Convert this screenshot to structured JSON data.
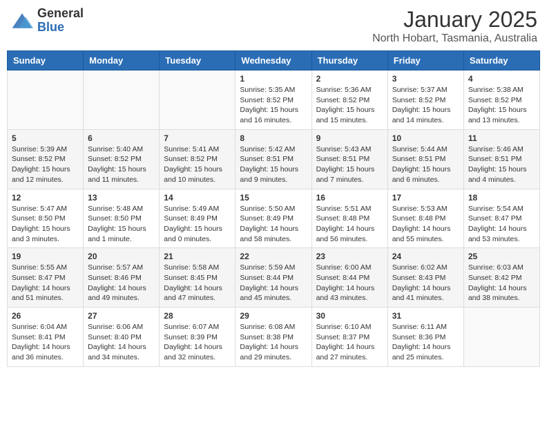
{
  "logo": {
    "general": "General",
    "blue": "Blue"
  },
  "header": {
    "month": "January 2025",
    "location": "North Hobart, Tasmania, Australia"
  },
  "weekdays": [
    "Sunday",
    "Monday",
    "Tuesday",
    "Wednesday",
    "Thursday",
    "Friday",
    "Saturday"
  ],
  "weeks": [
    [
      {
        "day": "",
        "info": ""
      },
      {
        "day": "",
        "info": ""
      },
      {
        "day": "",
        "info": ""
      },
      {
        "day": "1",
        "info": "Sunrise: 5:35 AM\nSunset: 8:52 PM\nDaylight: 15 hours\nand 16 minutes."
      },
      {
        "day": "2",
        "info": "Sunrise: 5:36 AM\nSunset: 8:52 PM\nDaylight: 15 hours\nand 15 minutes."
      },
      {
        "day": "3",
        "info": "Sunrise: 5:37 AM\nSunset: 8:52 PM\nDaylight: 15 hours\nand 14 minutes."
      },
      {
        "day": "4",
        "info": "Sunrise: 5:38 AM\nSunset: 8:52 PM\nDaylight: 15 hours\nand 13 minutes."
      }
    ],
    [
      {
        "day": "5",
        "info": "Sunrise: 5:39 AM\nSunset: 8:52 PM\nDaylight: 15 hours\nand 12 minutes."
      },
      {
        "day": "6",
        "info": "Sunrise: 5:40 AM\nSunset: 8:52 PM\nDaylight: 15 hours\nand 11 minutes."
      },
      {
        "day": "7",
        "info": "Sunrise: 5:41 AM\nSunset: 8:52 PM\nDaylight: 15 hours\nand 10 minutes."
      },
      {
        "day": "8",
        "info": "Sunrise: 5:42 AM\nSunset: 8:51 PM\nDaylight: 15 hours\nand 9 minutes."
      },
      {
        "day": "9",
        "info": "Sunrise: 5:43 AM\nSunset: 8:51 PM\nDaylight: 15 hours\nand 7 minutes."
      },
      {
        "day": "10",
        "info": "Sunrise: 5:44 AM\nSunset: 8:51 PM\nDaylight: 15 hours\nand 6 minutes."
      },
      {
        "day": "11",
        "info": "Sunrise: 5:46 AM\nSunset: 8:51 PM\nDaylight: 15 hours\nand 4 minutes."
      }
    ],
    [
      {
        "day": "12",
        "info": "Sunrise: 5:47 AM\nSunset: 8:50 PM\nDaylight: 15 hours\nand 3 minutes."
      },
      {
        "day": "13",
        "info": "Sunrise: 5:48 AM\nSunset: 8:50 PM\nDaylight: 15 hours\nand 1 minute."
      },
      {
        "day": "14",
        "info": "Sunrise: 5:49 AM\nSunset: 8:49 PM\nDaylight: 15 hours\nand 0 minutes."
      },
      {
        "day": "15",
        "info": "Sunrise: 5:50 AM\nSunset: 8:49 PM\nDaylight: 14 hours\nand 58 minutes."
      },
      {
        "day": "16",
        "info": "Sunrise: 5:51 AM\nSunset: 8:48 PM\nDaylight: 14 hours\nand 56 minutes."
      },
      {
        "day": "17",
        "info": "Sunrise: 5:53 AM\nSunset: 8:48 PM\nDaylight: 14 hours\nand 55 minutes."
      },
      {
        "day": "18",
        "info": "Sunrise: 5:54 AM\nSunset: 8:47 PM\nDaylight: 14 hours\nand 53 minutes."
      }
    ],
    [
      {
        "day": "19",
        "info": "Sunrise: 5:55 AM\nSunset: 8:47 PM\nDaylight: 14 hours\nand 51 minutes."
      },
      {
        "day": "20",
        "info": "Sunrise: 5:57 AM\nSunset: 8:46 PM\nDaylight: 14 hours\nand 49 minutes."
      },
      {
        "day": "21",
        "info": "Sunrise: 5:58 AM\nSunset: 8:45 PM\nDaylight: 14 hours\nand 47 minutes."
      },
      {
        "day": "22",
        "info": "Sunrise: 5:59 AM\nSunset: 8:44 PM\nDaylight: 14 hours\nand 45 minutes."
      },
      {
        "day": "23",
        "info": "Sunrise: 6:00 AM\nSunset: 8:44 PM\nDaylight: 14 hours\nand 43 minutes."
      },
      {
        "day": "24",
        "info": "Sunrise: 6:02 AM\nSunset: 8:43 PM\nDaylight: 14 hours\nand 41 minutes."
      },
      {
        "day": "25",
        "info": "Sunrise: 6:03 AM\nSunset: 8:42 PM\nDaylight: 14 hours\nand 38 minutes."
      }
    ],
    [
      {
        "day": "26",
        "info": "Sunrise: 6:04 AM\nSunset: 8:41 PM\nDaylight: 14 hours\nand 36 minutes."
      },
      {
        "day": "27",
        "info": "Sunrise: 6:06 AM\nSunset: 8:40 PM\nDaylight: 14 hours\nand 34 minutes."
      },
      {
        "day": "28",
        "info": "Sunrise: 6:07 AM\nSunset: 8:39 PM\nDaylight: 14 hours\nand 32 minutes."
      },
      {
        "day": "29",
        "info": "Sunrise: 6:08 AM\nSunset: 8:38 PM\nDaylight: 14 hours\nand 29 minutes."
      },
      {
        "day": "30",
        "info": "Sunrise: 6:10 AM\nSunset: 8:37 PM\nDaylight: 14 hours\nand 27 minutes."
      },
      {
        "day": "31",
        "info": "Sunrise: 6:11 AM\nSunset: 8:36 PM\nDaylight: 14 hours\nand 25 minutes."
      },
      {
        "day": "",
        "info": ""
      }
    ]
  ]
}
